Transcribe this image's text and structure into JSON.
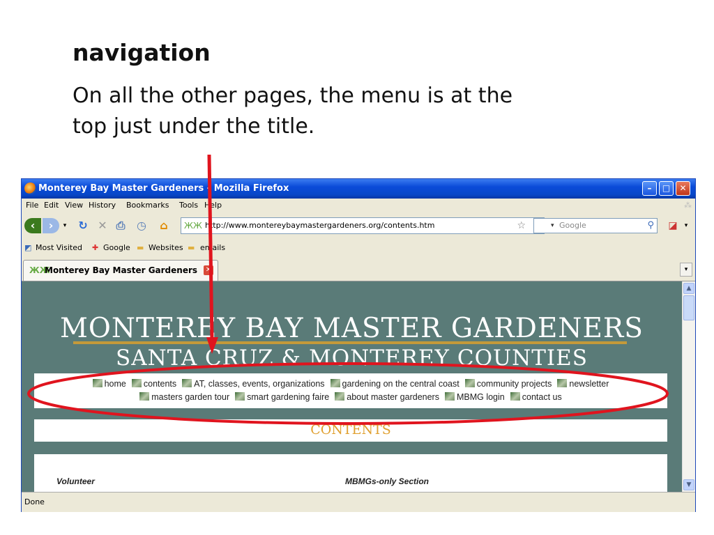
{
  "slide": {
    "heading": "navigation",
    "body": "On all the other pages, the menu is at the top just under the title."
  },
  "browser": {
    "window_title": "Monterey Bay Master Gardeners - Mozilla Firefox",
    "menus": [
      "File",
      "Edit",
      "View",
      "History",
      "Bookmarks",
      "Tools",
      "Help"
    ],
    "url": "http://www.montereybaymastergardeners.org/contents.htm",
    "search_placeholder": "Google",
    "bookmarks": [
      "Most Visited",
      "Google",
      "Websites",
      "emails"
    ],
    "tab_label": "Monterey Bay Master Gardeners",
    "status": "Done"
  },
  "site": {
    "title_line1": "MONTEREY BAY MASTER GARDENERS",
    "title_line2": "SANTA CRUZ & MONTEREY COUNTIES",
    "menu_row1": [
      "home",
      "contents",
      "AT, classes, events, organizations",
      "gardening on the central coast",
      "community projects",
      "newsletter"
    ],
    "menu_row2": [
      "masters garden tour",
      "smart gardening faire",
      "about master gardeners",
      "MBMG login",
      "contact us"
    ],
    "contents_heading": "CONTENTS",
    "col1_heading": "Volunteer",
    "col2_heading": "MBMGs-only Section"
  },
  "colors": {
    "page_bg": "#5a7b78",
    "accent_gold": "#c49a3a",
    "annotation_red": "#e0141e",
    "contents_orange": "#e0a030"
  }
}
